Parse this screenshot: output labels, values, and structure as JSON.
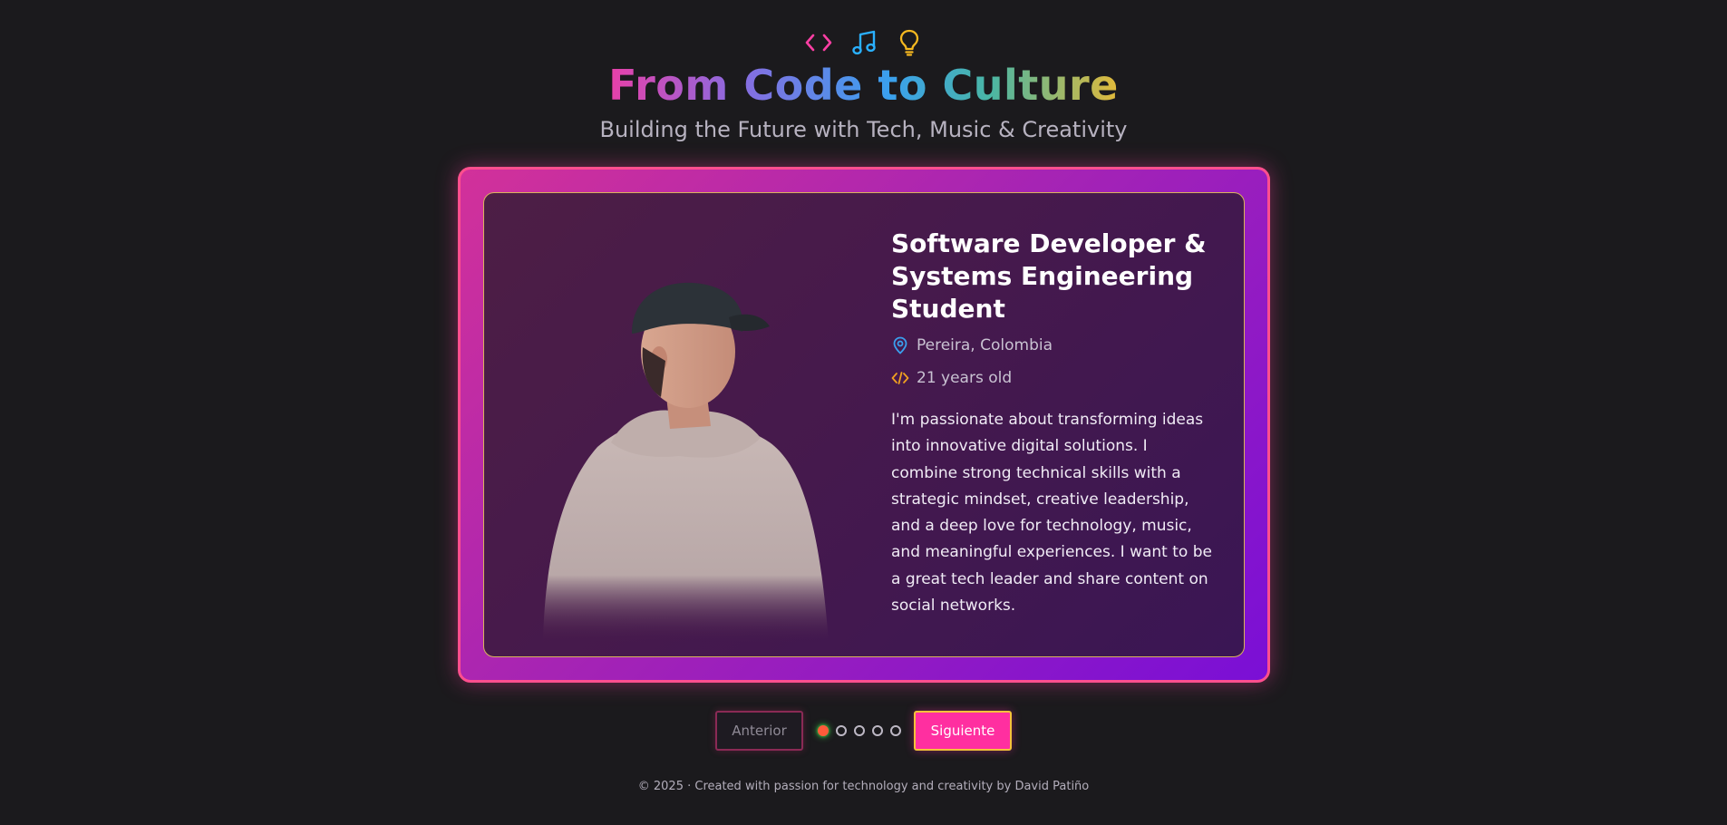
{
  "header": {
    "icons": [
      "code-icon",
      "music-note-icon",
      "lightbulb-icon"
    ],
    "title": "From Code to Culture",
    "subtitle": "Building the Future with Tech, Music & Creativity"
  },
  "card": {
    "photo_icon": "person-photo",
    "role": "Software Developer & Systems Engineering Student",
    "location": "Pereira, Colombia",
    "location_icon": "map-pin-icon",
    "age": "21 years old",
    "age_icon": "code-icon",
    "bio": "I'm passionate about transforming ideas into innovative digital solutions. I combine strong technical skills with a strategic mindset, creative leadership, and a deep love for technology, music, and meaningful experiences. I want to be a great tech leader and share content on social networks."
  },
  "navigation": {
    "prev_label": "Anterior",
    "next_label": "Siguiente",
    "total_slides": 5,
    "active_slide": 1
  },
  "footer": {
    "text": "© 2025 · Created with passion for technology and creativity by David Patiño"
  },
  "colors": {
    "background": "#1b1a1d",
    "accent_pink": "#ff2fa0",
    "accent_purple": "#7a0fd6",
    "accent_gold": "#f3c23a",
    "location_icon": "#3aa0ee",
    "age_icon": "#f0a020"
  }
}
